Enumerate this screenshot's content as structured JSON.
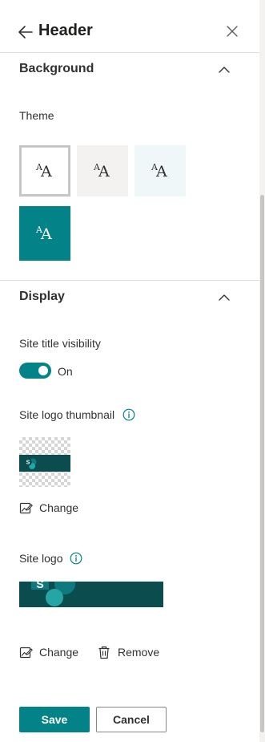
{
  "panel": {
    "title": "Header"
  },
  "background_section": {
    "title": "Background",
    "theme_label": "Theme",
    "themes": [
      {
        "name": "white",
        "bg": "#ffffff",
        "fg": "#323130",
        "selected": true
      },
      {
        "name": "neutral",
        "bg": "#f3f2f1",
        "fg": "#323130",
        "selected": false
      },
      {
        "name": "soft",
        "bg": "#eff7f8",
        "fg": "#323130",
        "selected": false
      },
      {
        "name": "strong",
        "bg": "#038387",
        "fg": "#ffffff",
        "selected": false
      }
    ],
    "theme_glyph_small": "A",
    "theme_glyph_big": "A"
  },
  "display_section": {
    "title": "Display",
    "site_title_visibility": {
      "label": "Site title visibility",
      "state": "On",
      "on": true
    },
    "site_logo_thumbnail": {
      "label": "Site logo thumbnail",
      "change_label": "Change",
      "logo_letter": "S"
    },
    "site_logo": {
      "label": "Site logo",
      "change_label": "Change",
      "remove_label": "Remove",
      "logo_letter": "S"
    }
  },
  "footer": {
    "save_label": "Save",
    "cancel_label": "Cancel"
  },
  "colors": {
    "accent": "#038387",
    "logo_dark": "#0b4d4f",
    "logo_mid": "#0f7a7d",
    "logo_light": "#25a5a5"
  }
}
